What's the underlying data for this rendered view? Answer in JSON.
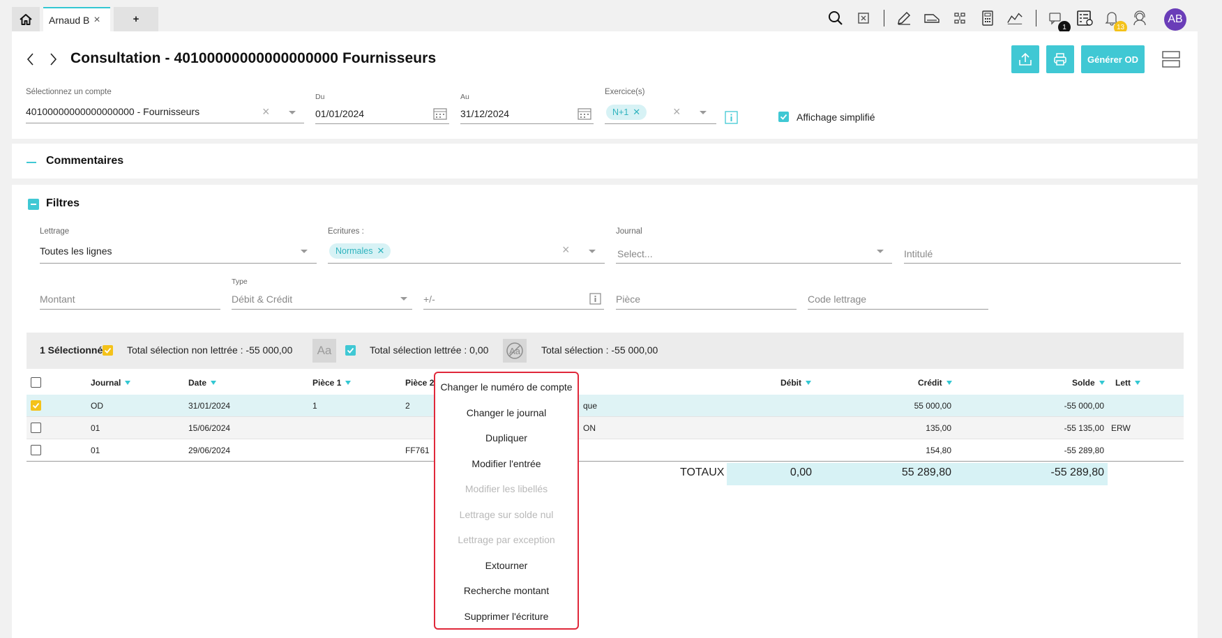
{
  "tabs": {
    "user_tab": "Arnaud B",
    "close_symbol": "×",
    "add_tab": "+"
  },
  "topbar": {
    "messages_badge": "1",
    "notifications_badge": "13",
    "avatar_initials": "AB"
  },
  "header": {
    "title": "Consultation - 40100000000000000000 Fournisseurs",
    "generate_od_label": "Générer OD"
  },
  "filters_top": {
    "account_label": "Sélectionnez un compte",
    "account_value": "40100000000000000000 - Fournisseurs",
    "from_label": "Du",
    "from_value": "01/01/2024",
    "to_label": "Au",
    "to_value": "31/12/2024",
    "exercise_label": "Exercice(s)",
    "exercise_chip": "N+1",
    "simplified_label": "Affichage simplifié"
  },
  "comments": {
    "toggle": "—",
    "title": "Commentaires"
  },
  "filters": {
    "title": "Filtres",
    "lettrage_label": "Lettrage",
    "lettrage_value": "Toutes les lignes",
    "ecritures_label": "Ecritures :",
    "ecritures_chip": "Normales",
    "journal_label": "Journal",
    "journal_placeholder": "Select...",
    "intitule_placeholder": "Intitulé",
    "montant_placeholder": "Montant",
    "type_label": "Type",
    "type_value": "Débit & Crédit",
    "plusminus_placeholder": "+/-",
    "piece_placeholder": "Pièce",
    "code_lettrage_placeholder": "Code lettrage"
  },
  "selection": {
    "count": "1 Sélectionné",
    "non_lettree": "Total sélection non lettrée : -55 000,00",
    "aa_button": "Aa",
    "lettree": "Total sélection lettrée : 0,00",
    "total": "Total sélection : -55 000,00"
  },
  "table": {
    "headers": {
      "journal": "Journal",
      "date": "Date",
      "piece1": "Pièce 1",
      "piece2": "Pièce 2",
      "debit": "Débit",
      "credit": "Crédit",
      "solde": "Solde",
      "lett": "Lett"
    },
    "rows": [
      {
        "journal": "OD",
        "date": "31/01/2024",
        "piece1": "1",
        "piece2": "2",
        "libelle": "que",
        "debit": "",
        "credit": "55 000,00",
        "solde": "-55 000,00",
        "lett": ""
      },
      {
        "journal": "01",
        "date": "15/06/2024",
        "piece1": "",
        "piece2": "",
        "libelle": "ON",
        "debit": "",
        "credit": "135,00",
        "solde": "-55 135,00",
        "lett": "ERW"
      },
      {
        "journal": "01",
        "date": "29/06/2024",
        "piece1": "",
        "piece2": "FF761",
        "libelle": "",
        "debit": "",
        "credit": "154,80",
        "solde": "-55 289,80",
        "lett": ""
      }
    ],
    "totals": {
      "label": "TOTAUX",
      "debit": "0,00",
      "credit": "55 289,80",
      "solde": "-55 289,80"
    }
  },
  "context_menu": [
    {
      "label": "Changer le numéro de compte",
      "disabled": false
    },
    {
      "label": "Changer le journal",
      "disabled": false
    },
    {
      "label": "Dupliquer",
      "disabled": false
    },
    {
      "label": "Modifier l'entrée",
      "disabled": false
    },
    {
      "label": "Modifier les libellés",
      "disabled": true
    },
    {
      "label": "Lettrage sur solde nul",
      "disabled": true
    },
    {
      "label": "Lettrage par exception",
      "disabled": true
    },
    {
      "label": "Extourner",
      "disabled": false
    },
    {
      "label": "Recherche montant",
      "disabled": false
    },
    {
      "label": "Supprimer l'écriture",
      "disabled": false
    }
  ],
  "colors": {
    "accent": "#40c8d4",
    "selected_row": "#dff3f5",
    "highlight_border": "#e0283a",
    "checkbox_selected": "#f4c21a",
    "avatar": "#6a3db8"
  },
  "icons": [
    "home-icon",
    "search-icon",
    "calculator-icon",
    "edit-icon",
    "scanner-icon",
    "hierarchy-icon",
    "calc-grid-icon",
    "chart-icon",
    "chat-icon",
    "tasks-icon",
    "bell-icon",
    "support-icon",
    "upload-icon",
    "print-icon",
    "layout-icon",
    "calendar-icon",
    "info-icon"
  ]
}
